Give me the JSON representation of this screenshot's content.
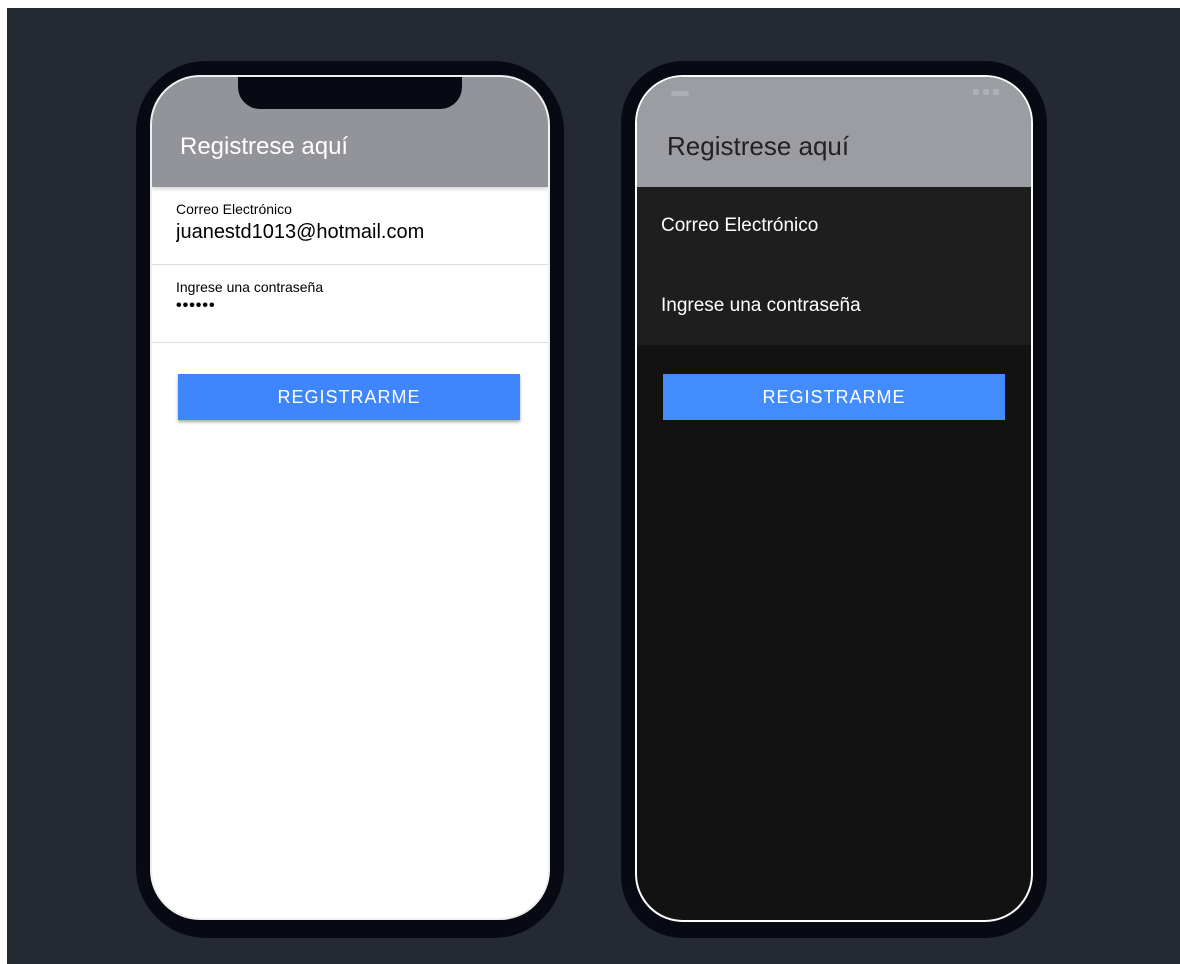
{
  "light_phone": {
    "header_title": "Registrese aquí",
    "email_label": "Correo Electrónico",
    "email_value": "juanestd1013@hotmail.com",
    "password_label": "Ingrese una contraseña",
    "password_value": "••••••",
    "register_button_label": "REGISTRARME"
  },
  "dark_phone": {
    "header_title": "Registrese aquí",
    "email_label": "Correo Electrónico",
    "password_label": "Ingrese una contraseña",
    "register_button_label": "REGISTRARME"
  },
  "colors": {
    "background": "#252a32",
    "phone_frame": "#070a12",
    "toolbar_light": "#92949a",
    "toolbar_dark": "#9c9da3",
    "button_primary": "#3f85fc",
    "dark_screen": "#121212",
    "dark_form": "#1e1e1e"
  }
}
